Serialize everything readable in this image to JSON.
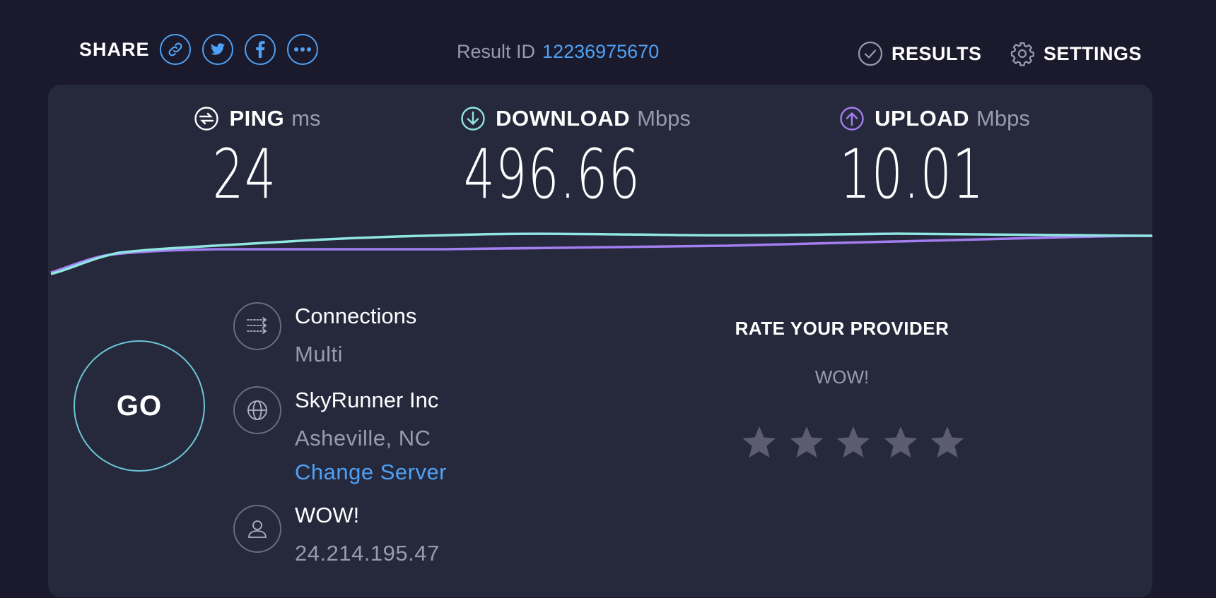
{
  "topbar": {
    "share_label": "SHARE",
    "share_icons": [
      "link-icon",
      "twitter-icon",
      "facebook-icon",
      "more-icon"
    ],
    "result_id_label": "Result ID",
    "result_id_value": "12236975670",
    "results_label": "RESULTS",
    "settings_label": "SETTINGS"
  },
  "metrics": {
    "ping": {
      "label": "PING",
      "unit": "ms",
      "value": "24"
    },
    "download": {
      "label": "DOWNLOAD",
      "unit": "Mbps",
      "value": "496.66"
    },
    "upload": {
      "label": "UPLOAD",
      "unit": "Mbps",
      "value": "10.01"
    }
  },
  "go_label": "GO",
  "connections": {
    "title": "Connections",
    "value": "Multi"
  },
  "server": {
    "name": "SkyRunner Inc",
    "location": "Asheville, NC",
    "change_label": "Change Server"
  },
  "isp": {
    "name": "WOW!",
    "ip": "24.214.195.47"
  },
  "rate": {
    "title": "RATE YOUR PROVIDER",
    "provider": "WOW!",
    "stars_total": 5,
    "stars_selected": 0
  },
  "colors": {
    "background": "#1a1a2c",
    "card": "#26283c",
    "accent_blue": "#4ea1f5",
    "download_line": "#8fe6e2",
    "upload_line": "#a37ef0",
    "muted_text": "#9a9aae",
    "star": "#5b5c70"
  }
}
